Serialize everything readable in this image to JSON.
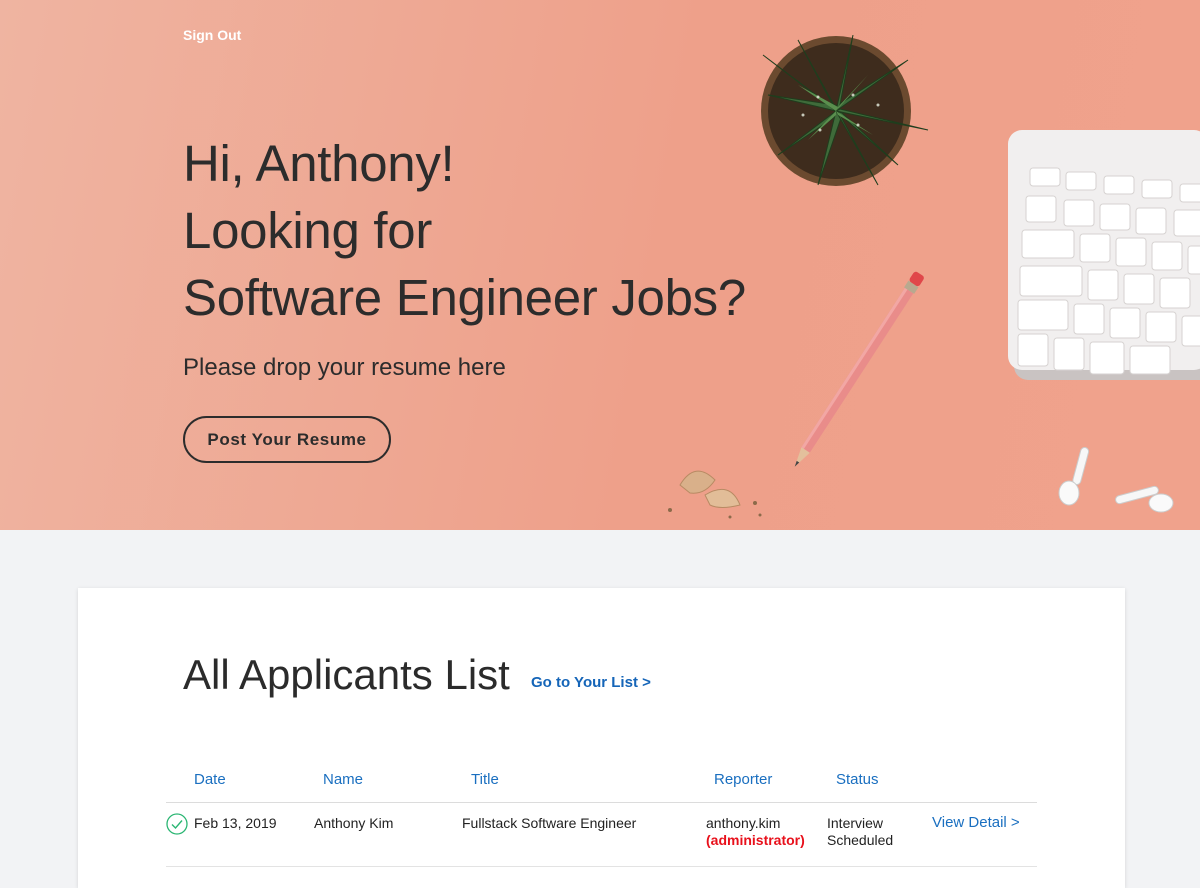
{
  "header": {
    "sign_out_label": "Sign Out"
  },
  "hero": {
    "headline_line1": "Hi, Anthony!",
    "headline_line2": "Looking for",
    "headline_line3": "Software Engineer Jobs?",
    "subline": "Please drop your resume here",
    "cta_label": "Post Your Resume",
    "background_color": "#eea08a"
  },
  "applicants": {
    "title": "All Applicants List",
    "goto_link": "Go to Your List >",
    "columns": [
      "Date",
      "Name",
      "Title",
      "Reporter",
      "Status"
    ],
    "rows": [
      {
        "date": "Feb 13, 2019",
        "name": "Anthony Kim",
        "title": "Fullstack Software Engineer",
        "reporter": "anthony.kim",
        "reporter_role": "(administrator)",
        "status_line1": "Interview",
        "status_line2": "Scheduled",
        "action": "View Detail >",
        "status_icon": "check-circle-icon"
      }
    ]
  },
  "colors": {
    "link": "#1a6fc0",
    "admin": "#e8101b",
    "check": "#2bb673"
  }
}
